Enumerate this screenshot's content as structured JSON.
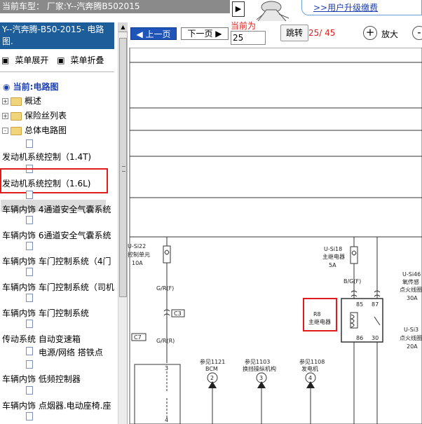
{
  "top": {
    "car_label": "当前车型：  厂家:Y--汽奔腾B502015",
    "upgrade_link": ">>用户升级缴费",
    "arrow_icon": "play-arrow-icon"
  },
  "sidebar": {
    "title": "Y--汽奔腾-B50-2015- 电路图.",
    "expand_label": "菜单展开",
    "collapse_label": "菜单折叠",
    "current_label": "当前:电路图",
    "folders": [
      {
        "label": "概述",
        "state": "+"
      },
      {
        "label": "保险丝列表",
        "state": "+"
      },
      {
        "label": "总体电路图",
        "state": "-"
      }
    ],
    "items": [
      "发动机系统控制（1.4T)",
      "发动机系统控制（1.6L)",
      "车辆内饰 4通道安全气囊系统",
      "车辆内饰 6通道安全气囊系统",
      "车辆内饰 车门控制系统（4门",
      "车辆内饰 车门控制系统（司机",
      "车辆内饰 车门控制系统",
      "传动系统 自动变速箱",
      "电源/网络 搭铁点",
      "车辆内饰 低频控制器",
      "车辆内饰 点烟器.电动座椅.座"
    ],
    "selected_item": "发动机系统控制（1.6L)"
  },
  "toolbar": {
    "prev_label": "上一页",
    "next_label": "下一页",
    "current_label": "当前为",
    "page_value": "25",
    "jump_label": "跳转",
    "page_count": "25/ 45",
    "zoom_in_label": "放大",
    "zoom_in_icon": "zoom-in-icon",
    "zoom_out_icon": "zoom-out-icon"
  },
  "diagram": {
    "labels": {
      "usi22": "U-Si22",
      "usi22_desc": "控制单元",
      "usi22_amp": "10A",
      "gr_f": "G/R(F)",
      "c3": "C3",
      "c7": "C7",
      "gr_r": "G/R(R)",
      "pin3": "3",
      "pin4": "4",
      "ref1121": "参见1121",
      "bcm": "BCM",
      "ref1103": "参见1103",
      "shift": "换挡操纵机构",
      "ref1108": "参见1108",
      "gen": "发电机",
      "c2": "2",
      "c3n": "3",
      "c4": "4",
      "usi18": "U-Si18",
      "usi18_desc": "主继电器",
      "usi18_amp": "5A",
      "bg_f": "B/G(F)",
      "r8": "R8",
      "r8_desc": "主继电器",
      "p85": "85",
      "p87": "87",
      "p86": "86",
      "p30": "30",
      "usi46": "U-Si46",
      "usi46_desc1": "氧传感",
      "usi46_desc2": "点火线圈",
      "usi46_amp": "30A",
      "usi3x": "U-Si3",
      "usi3x_desc": "点火线圈",
      "usi3x_amp": "20A"
    }
  }
}
